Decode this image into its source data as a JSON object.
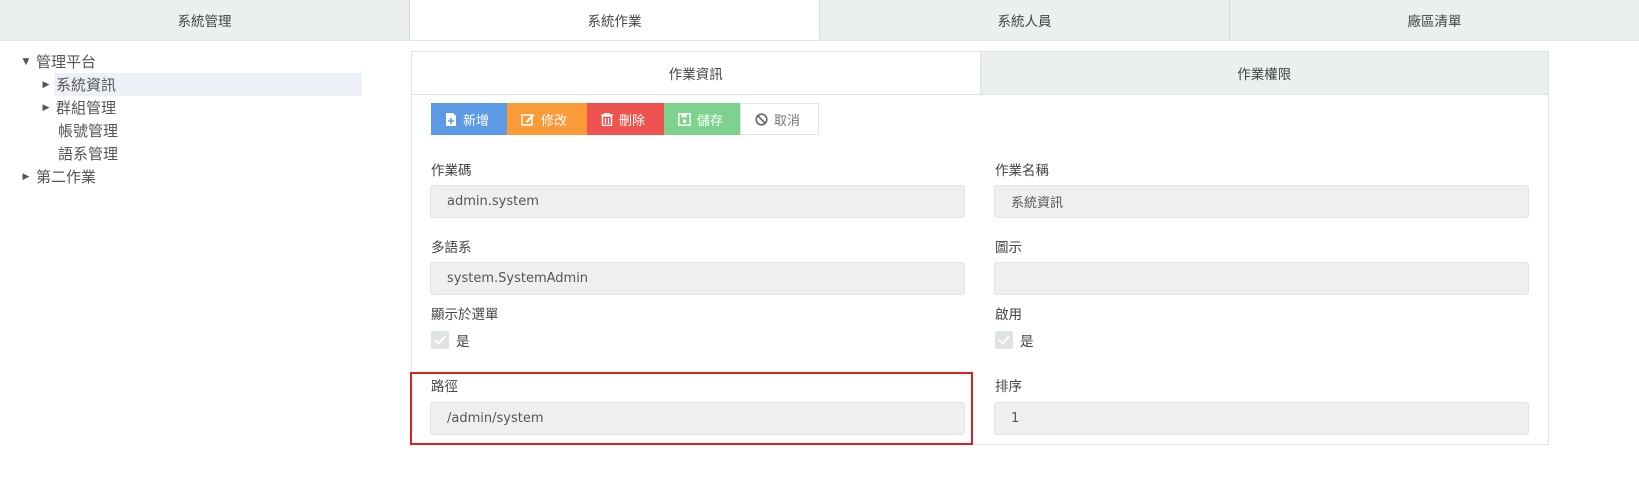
{
  "top_tabs": [
    {
      "label": "系統管理",
      "active": false
    },
    {
      "label": "系統作業",
      "active": true
    },
    {
      "label": "系統人員",
      "active": false
    },
    {
      "label": "廠區清單",
      "active": false
    }
  ],
  "tree": {
    "root1": "管理平台",
    "children": [
      "系統資訊",
      "群組管理",
      "帳號管理",
      "語系管理"
    ],
    "root2": "第二作業"
  },
  "inner_tabs": [
    {
      "label": "作業資訊",
      "active": true
    },
    {
      "label": "作業權限",
      "active": false
    }
  ],
  "toolbar": {
    "add": "新增",
    "edit": "修改",
    "delete": "刪除",
    "save": "儲存",
    "cancel": "取消"
  },
  "form": {
    "job_code_label": "作業碼",
    "job_code_value": "admin.system",
    "job_name_label": "作業名稱",
    "job_name_value": "系統資訊",
    "lang_label": "多語系",
    "lang_value": "system.SystemAdmin",
    "icon_label": "圖示",
    "icon_value": "",
    "show_menu_label": "顯示於選單",
    "show_menu_text": "是",
    "enabled_label": "啟用",
    "enabled_text": "是",
    "path_label": "路徑",
    "path_value": "/admin/system",
    "sort_label": "排序",
    "sort_value": "1"
  },
  "colors": {
    "add": "#5c9ae6",
    "edit": "#fb9a39",
    "delete": "#ef5350",
    "save": "#7dd38d",
    "highlight": "#e02020"
  }
}
